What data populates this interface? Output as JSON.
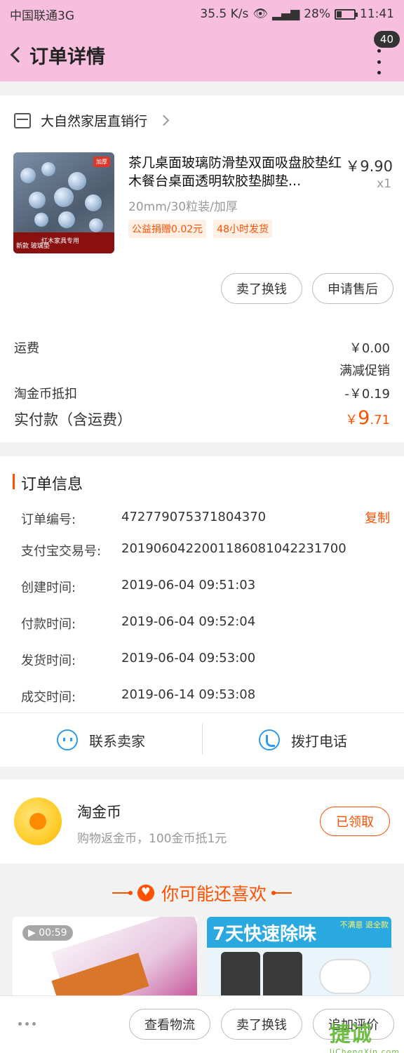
{
  "status_bar": {
    "carrier": "中国联通3G",
    "speed": "35.5 K/s",
    "battery_pct": "28%",
    "battery_level": 0.28,
    "time": "11:41"
  },
  "nav": {
    "title": "订单详情",
    "badge": "40"
  },
  "shop": {
    "name": "大自然家居直销行"
  },
  "product": {
    "title": "茶几桌面玻璃防滑垫双面吸盘胶垫红木餐台桌面透明软胶垫脚垫...",
    "price": "￥9.90",
    "qty": "x1",
    "spec": "20mm/30粒装/加厚",
    "tags": [
      "公益捐赠0.02元",
      "48小时发货"
    ],
    "img_tag": "加厚",
    "img_strip_left": "新款 玻璃垫",
    "img_strip_right": "红木家具专用"
  },
  "item_actions": {
    "sell": "卖了换钱",
    "after_sale": "申请售后"
  },
  "fees": {
    "shipping_label": "运费",
    "shipping_value": "￥0.00",
    "promo": "满减促销",
    "coin_label": "淘金币抵扣",
    "coin_value": "-￥0.19",
    "paid_label": "实付款（含运费）",
    "paid_symbol": "￥",
    "paid_int": "9",
    "paid_dec": ".71"
  },
  "order_info": {
    "title": "订单信息",
    "copy": "复制",
    "rows": [
      {
        "label": "订单编号:",
        "value": "472779075371804370"
      },
      {
        "label": "支付宝交易号:",
        "value": "2019060422001186081042231700"
      },
      {
        "label": "创建时间:",
        "value": "2019-06-04 09:51:03"
      },
      {
        "label": "付款时间:",
        "value": "2019-06-04 09:52:04"
      },
      {
        "label": "发货时间:",
        "value": "2019-06-04 09:53:00"
      },
      {
        "label": "成交时间:",
        "value": "2019-06-14 09:53:08"
      }
    ]
  },
  "contact": {
    "seller": "联系卖家",
    "call": "拨打电话"
  },
  "coins": {
    "title": "淘金币",
    "desc": "购物返金币，100金币抵1元",
    "button": "已领取"
  },
  "recommend": {
    "title": "你可能还喜欢",
    "item1_duration": "00:59",
    "item2_banner": "7天快速除味",
    "item2_sub": "不满意 退全款"
  },
  "bottom_bar": {
    "logistics": "查看物流",
    "sell": "卖了换钱",
    "review": "追加评价"
  },
  "watermark": {
    "text": "捷诚",
    "domain": "JiChengXin.com"
  },
  "colors": {
    "accent": "#ff5000",
    "header": "#f7bfdd",
    "link_blue": "#2d9bf0"
  }
}
